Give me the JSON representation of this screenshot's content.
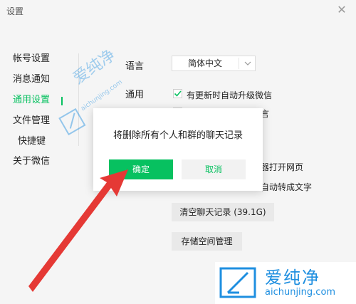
{
  "window": {
    "title": "设置",
    "close_glyph": "✕"
  },
  "sidebar": {
    "items": [
      {
        "label": "帐号设置",
        "active": false
      },
      {
        "label": "消息通知",
        "active": false
      },
      {
        "label": "通用设置",
        "active": true
      },
      {
        "label": "文件管理",
        "active": false
      },
      {
        "label": "快捷键",
        "active": false
      },
      {
        "label": "关于微信",
        "active": false
      }
    ]
  },
  "general": {
    "language_label": "语言",
    "language_value": "简体中文",
    "general_label": "通用",
    "options": [
      {
        "text": "有更新时自动升级微信",
        "checked": true
      },
      {
        "text": "言",
        "checked": false
      },
      {
        "text": "器打开网页",
        "checked": false
      },
      {
        "text": "自动转成文字",
        "checked": false
      }
    ],
    "clear_chat_button": "清空聊天记录 (39.1G)",
    "storage_button": "存储空间管理"
  },
  "dialog": {
    "message": "将删除所有个人和群的聊天记录",
    "confirm": "确定",
    "cancel": "取消"
  },
  "watermark": {
    "brand": "爱纯净",
    "site": "aichunjing.com"
  },
  "colors": {
    "accent": "#07c160",
    "arrow": "#e53935",
    "watermark": "#1f8fe0"
  },
  "icons": [
    "close-icon",
    "chevron-down-icon",
    "checkmark-icon",
    "arrow-annotation",
    "watermark-logo-icon"
  ]
}
